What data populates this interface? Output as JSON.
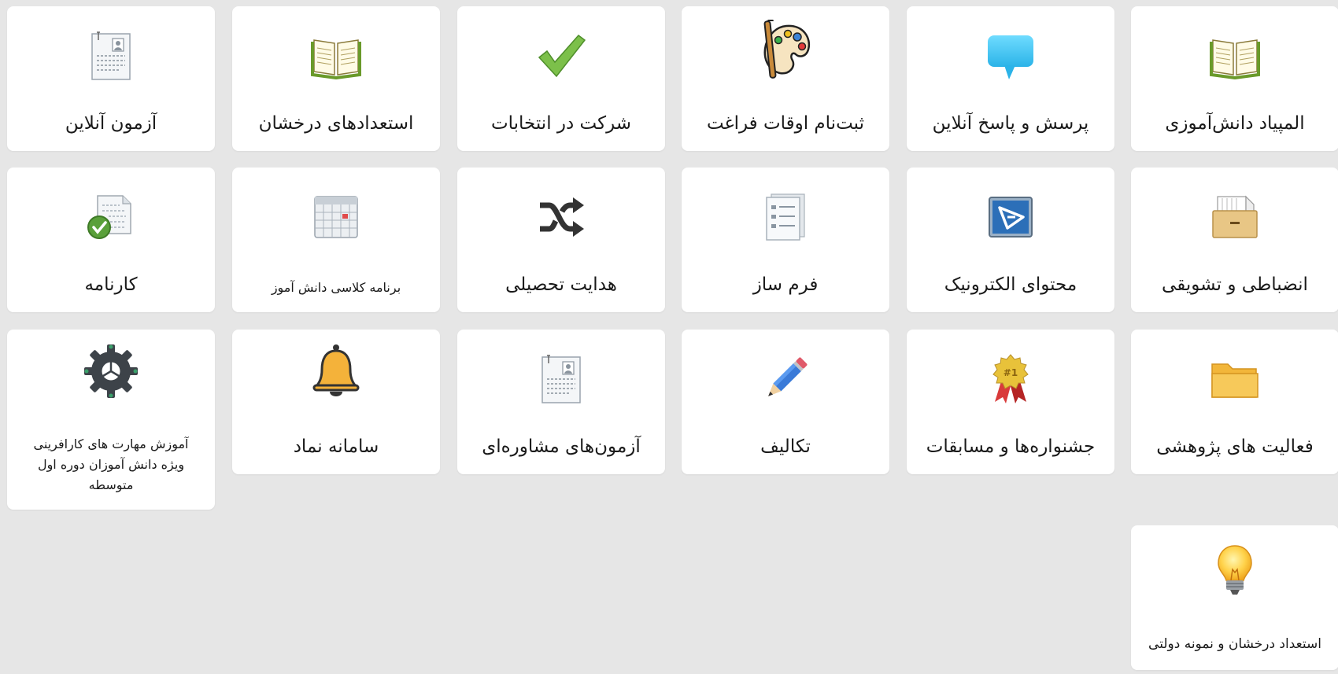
{
  "tiles": [
    {
      "key": "olympiad",
      "label": "المپیاد دانش‌آموزی",
      "icon": "open-book-icon"
    },
    {
      "key": "qa",
      "label": "پرسش و پاسخ آنلاین",
      "icon": "speech-bubble-icon"
    },
    {
      "key": "leisure",
      "label": "ثبت‌نام اوقات فراغت",
      "icon": "paint-palette-icon"
    },
    {
      "key": "elections",
      "label": "شرکت در انتخابات",
      "icon": "checkmark-icon"
    },
    {
      "key": "talents",
      "label": "استعدادهای درخشان",
      "icon": "open-book-icon"
    },
    {
      "key": "online-exam",
      "label": "آزمون آنلاین",
      "icon": "document-icon"
    },
    {
      "key": "discipline",
      "label": "انضباطی و تشویقی",
      "icon": "file-box-icon"
    },
    {
      "key": "econtent",
      "label": "محتوای الکترونیک",
      "icon": "presentation-icon"
    },
    {
      "key": "form-builder",
      "label": "فرم ساز",
      "icon": "form-list-icon"
    },
    {
      "key": "guidance",
      "label": "هدایت تحصیلی",
      "icon": "shuffle-icon"
    },
    {
      "key": "schedule",
      "label": "برنامه کلاسی دانش آموز",
      "icon": "calendar-icon"
    },
    {
      "key": "report-card",
      "label": "کارنامه",
      "icon": "report-check-icon"
    },
    {
      "key": "research",
      "label": "فعالیت های پژوهشی",
      "icon": "folder-icon"
    },
    {
      "key": "festivals",
      "label": "جشنواره‌ها و مسابقات",
      "icon": "award-ribbon-icon"
    },
    {
      "key": "homework",
      "label": "تکالیف",
      "icon": "pencil-icon"
    },
    {
      "key": "counseling",
      "label": "آزمون‌های مشاوره‌ای",
      "icon": "document-icon"
    },
    {
      "key": "namad",
      "label": "سامانه نماد",
      "icon": "bell-icon"
    },
    {
      "key": "entrepreneur",
      "label": "آموزش مهارت های کارافرینی ویژه دانش آموزان دوره اول متوسطه",
      "icon": "gear-icon"
    },
    {
      "key": "gifted-state",
      "label": "استعداد درخشان و نمونه دولتی",
      "icon": "light-bulb-icon"
    }
  ]
}
